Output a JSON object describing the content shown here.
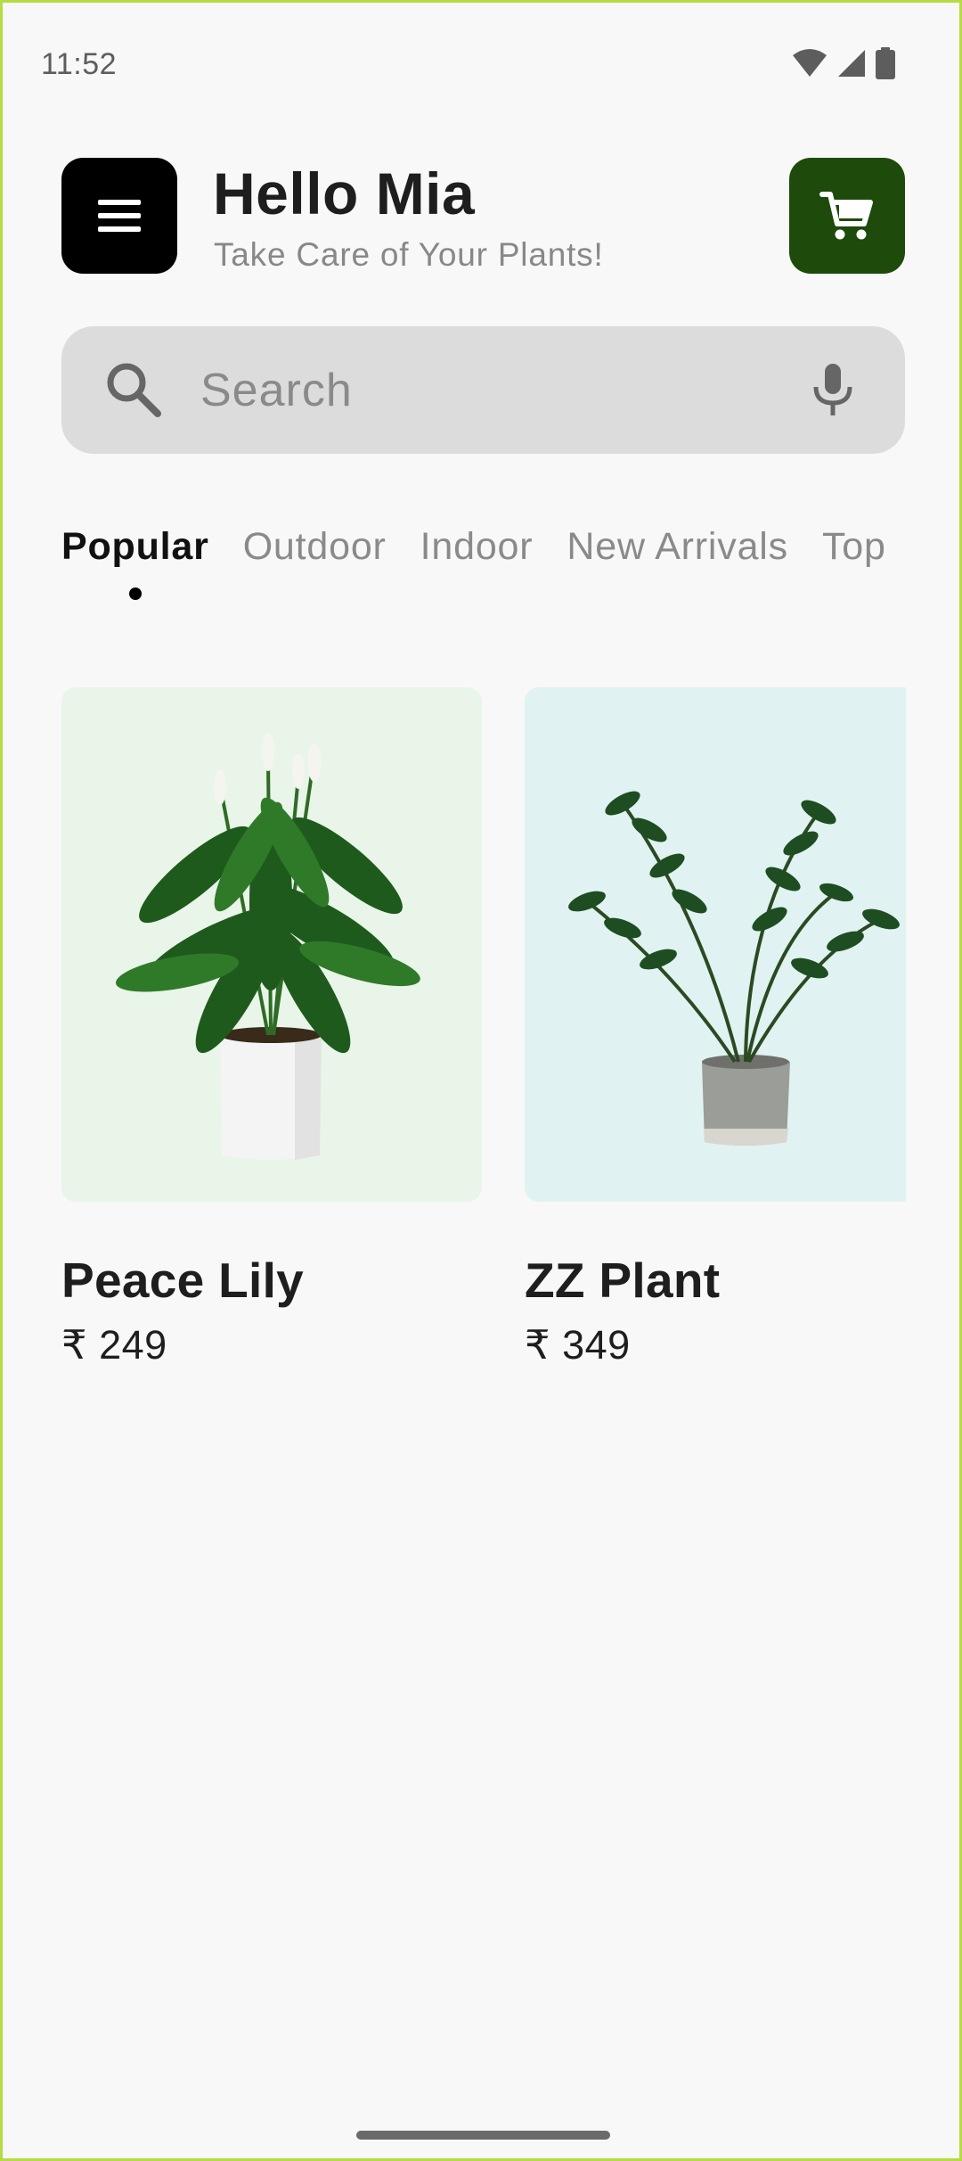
{
  "status_bar": {
    "time": "11:52",
    "icons": [
      "wifi-icon",
      "signal-icon",
      "battery-icon"
    ]
  },
  "header": {
    "menu_icon": "hamburger-menu-icon",
    "greeting": "Hello Mia",
    "subtitle": "Take Care of Your Plants!",
    "cart_icon": "cart-icon"
  },
  "search": {
    "placeholder": "Search",
    "value": "",
    "left_icon": "search-icon",
    "right_icon": "mic-icon"
  },
  "tabs": {
    "items": [
      {
        "label": "Popular",
        "active": true
      },
      {
        "label": "Outdoor",
        "active": false
      },
      {
        "label": "Indoor",
        "active": false
      },
      {
        "label": "New Arrivals",
        "active": false
      },
      {
        "label": "Top",
        "active": false
      }
    ]
  },
  "products": [
    {
      "name": "Peace Lily",
      "price": "₹ 249",
      "image_bg": "#e8f5e8"
    },
    {
      "name": "ZZ Plant",
      "price": "₹ 349",
      "image_bg": "#e0f2f1"
    }
  ],
  "colors": {
    "accent_green": "#1e4a0b",
    "menu_button": "#000000",
    "search_bg": "#dcdcdc",
    "page_bg": "#f8f8f8"
  }
}
